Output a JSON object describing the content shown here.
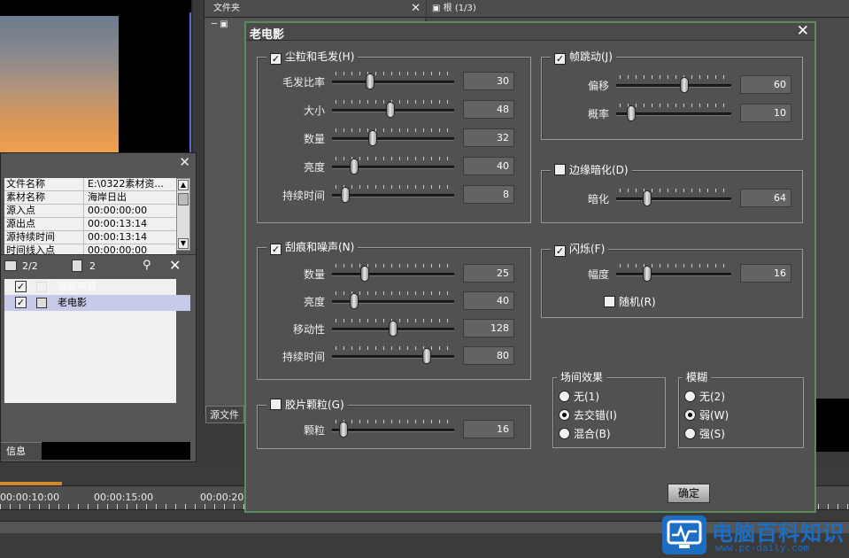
{
  "background": {
    "folder_tab": "文件夹",
    "bin_tab": "根 (1/3)",
    "source_file_tab": "源文件",
    "info_tab": "信息",
    "info_rows": [
      {
        "key": "文件名称",
        "value": "E:\\0322素材资..."
      },
      {
        "key": "素材名称",
        "value": "海岸日出"
      },
      {
        "key": "源入点",
        "value": "00:00:00:00"
      },
      {
        "key": "源出点",
        "value": "00:00:13:14"
      },
      {
        "key": "源持续时间",
        "value": "00:00:13:14"
      },
      {
        "key": "时间线入点",
        "value": "00:00:00:00"
      }
    ],
    "layer_count": "2/2",
    "filter_count": "2",
    "layers": [
      {
        "label": "视频布局",
        "checked": true
      },
      {
        "label": "老电影",
        "checked": true
      }
    ],
    "timecodes": [
      "00:00:10:00",
      "00:00:15:00",
      "00:00:20"
    ]
  },
  "dialog": {
    "title": "老电影",
    "close": "✕",
    "dust": {
      "label": "尘粒和毛发(H)",
      "checked": true,
      "sliders": [
        {
          "label": "毛发比率",
          "value": "30",
          "level": 0.3
        },
        {
          "label": "大小",
          "value": "48",
          "level": 0.48
        },
        {
          "label": "数量",
          "value": "32",
          "level": 0.32
        },
        {
          "label": "亮度",
          "value": "40",
          "level": 0.16
        },
        {
          "label": "持续时间",
          "value": "8",
          "level": 0.08
        }
      ]
    },
    "jitter": {
      "label": "帧跳动(J)",
      "checked": true,
      "sliders": [
        {
          "label": "偏移",
          "value": "60",
          "level": 0.6
        },
        {
          "label": "概率",
          "value": "10",
          "level": 0.1
        }
      ]
    },
    "vignette": {
      "label": "边缘暗化(D)",
      "checked": false,
      "sliders": [
        {
          "label": "暗化",
          "value": "64",
          "level": 0.25
        }
      ]
    },
    "scratch": {
      "label": "刮痕和噪声(N)",
      "checked": true,
      "sliders": [
        {
          "label": "数量",
          "value": "25",
          "level": 0.25
        },
        {
          "label": "亮度",
          "value": "40",
          "level": 0.16
        },
        {
          "label": "移动性",
          "value": "128",
          "level": 0.5
        },
        {
          "label": "持续时间",
          "value": "80",
          "level": 0.8
        }
      ]
    },
    "flicker": {
      "label": "闪烁(F)",
      "checked": true,
      "sliders": [
        {
          "label": "幅度",
          "value": "16",
          "level": 0.25
        }
      ],
      "random_label": "随机(R)",
      "random_checked": false
    },
    "grain": {
      "label": "胶片颗粒(G)",
      "checked": false,
      "sliders": [
        {
          "label": "颗粒",
          "value": "16",
          "level": 0.06
        }
      ]
    },
    "field": {
      "label": "场间效果",
      "options": [
        {
          "label": "无(1)",
          "selected": false
        },
        {
          "label": "去交错(I)",
          "selected": true
        },
        {
          "label": "混合(B)",
          "selected": false
        }
      ]
    },
    "blur": {
      "label": "模糊",
      "options": [
        {
          "label": "无(2)",
          "selected": false
        },
        {
          "label": "弱(W)",
          "selected": true
        },
        {
          "label": "强(S)",
          "selected": false
        }
      ]
    },
    "ok_label": "确定"
  },
  "watermark": {
    "brand": "电脑百科知识",
    "url": "www.pc-daily.com"
  }
}
